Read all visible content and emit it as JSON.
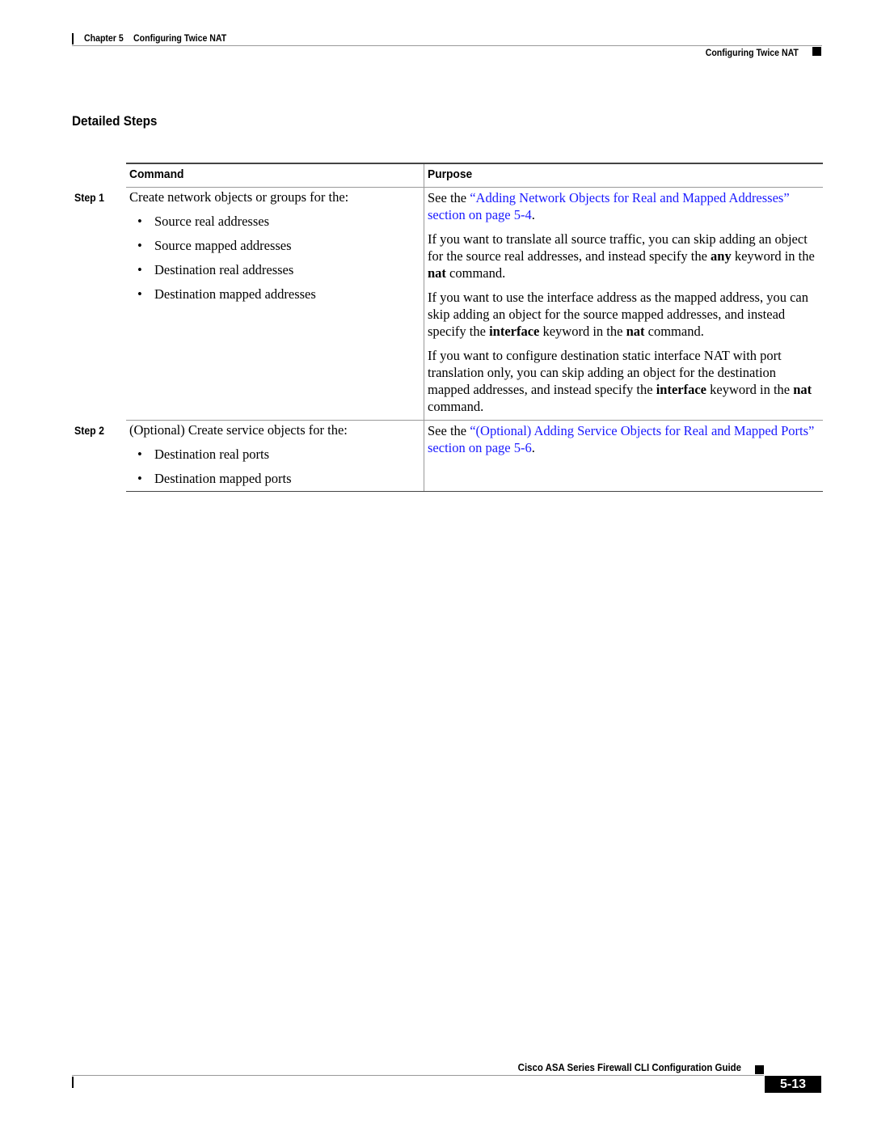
{
  "header": {
    "chapter_label": "Chapter 5",
    "chapter_title": "Configuring Twice NAT",
    "section_right": "Configuring Twice NAT"
  },
  "section_title": "Detailed Steps",
  "table": {
    "columns": [
      "Command",
      "Purpose"
    ],
    "rows": [
      {
        "step": "Step 1",
        "command": "Create network objects or groups for the:",
        "bullets": [
          "Source real addresses",
          "Source mapped addresses",
          "Destination real addresses",
          "Destination mapped addresses"
        ],
        "purpose": [
          {
            "prefix": "See the ",
            "link": "“Adding Network Objects for Real and Mapped Addresses” section on page 5-4",
            "suffix": "."
          },
          {
            "t1": "If you want to translate all source traffic, you can skip adding an object for the source real addresses, and instead specify the ",
            "b1": "any",
            "t2": " keyword in the ",
            "b2": "nat",
            "t3": " command."
          },
          {
            "t1": "If you want to use the interface address as the mapped address, you can skip adding an object for the source mapped addresses, and instead specify the ",
            "b1": "interface",
            "t2": " keyword in the ",
            "b2": "nat",
            "t3": " command."
          },
          {
            "t1": "If you want to configure destination static interface NAT with port translation only, you can skip adding an object for the destination mapped addresses, and instead specify the ",
            "b1": "interface",
            "t2": " keyword in the ",
            "b2": "nat",
            "t3": " command."
          }
        ]
      },
      {
        "step": "Step 2",
        "command": "(Optional) Create service objects for the:",
        "bullets": [
          "Destination real ports",
          "Destination mapped ports"
        ],
        "purpose": [
          {
            "prefix": "See the ",
            "link": "“(Optional) Adding Service Objects for Real and Mapped Ports” section on page 5-6",
            "suffix": "."
          }
        ]
      }
    ]
  },
  "footer": {
    "guide_title": "Cisco ASA Series Firewall CLI Configuration Guide",
    "page_number": "5-13"
  },
  "bullet_glyph": "•",
  "colors": {
    "link": "#1a1aff",
    "text": "#000000"
  }
}
